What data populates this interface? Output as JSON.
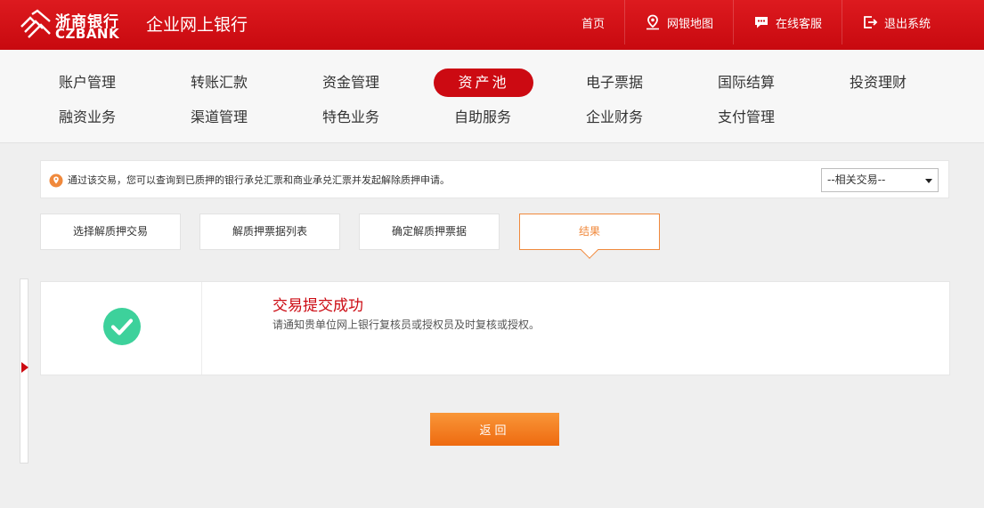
{
  "header": {
    "logo_cn": "浙商银行",
    "logo_en": "CZBANK",
    "title": "企业网上银行",
    "nav": [
      {
        "label": "首页",
        "icon": "none"
      },
      {
        "label": "网银地图",
        "icon": "map-pin-icon"
      },
      {
        "label": "在线客服",
        "icon": "chat-icon"
      },
      {
        "label": "退出系统",
        "icon": "logout-icon"
      }
    ]
  },
  "menu": {
    "row1": [
      "账户管理",
      "转账汇款",
      "资金管理",
      "资产池",
      "电子票据",
      "国际结算",
      "投资理财"
    ],
    "row2": [
      "融资业务",
      "渠道管理",
      "特色业务",
      "自助服务",
      "企业财务",
      "支付管理"
    ],
    "active": "资产池"
  },
  "notice": {
    "text": "通过该交易，您可以查询到已质押的银行承兑汇票和商业承兑汇票并发起解除质押申请。",
    "related_select": "--相关交易--"
  },
  "steps": [
    "选择解质押交易",
    "解质押票据列表",
    "确定解质押票据",
    "结果"
  ],
  "current_step": "结果",
  "result": {
    "title": "交易提交成功",
    "message": "请通知贵单位网上银行复核员或授权员及时复核或授权。"
  },
  "buttons": {
    "back": "返回"
  },
  "colors": {
    "brand_red": "#cc0a12",
    "accent_orange": "#f0893c",
    "success_green": "#3dd19b"
  }
}
